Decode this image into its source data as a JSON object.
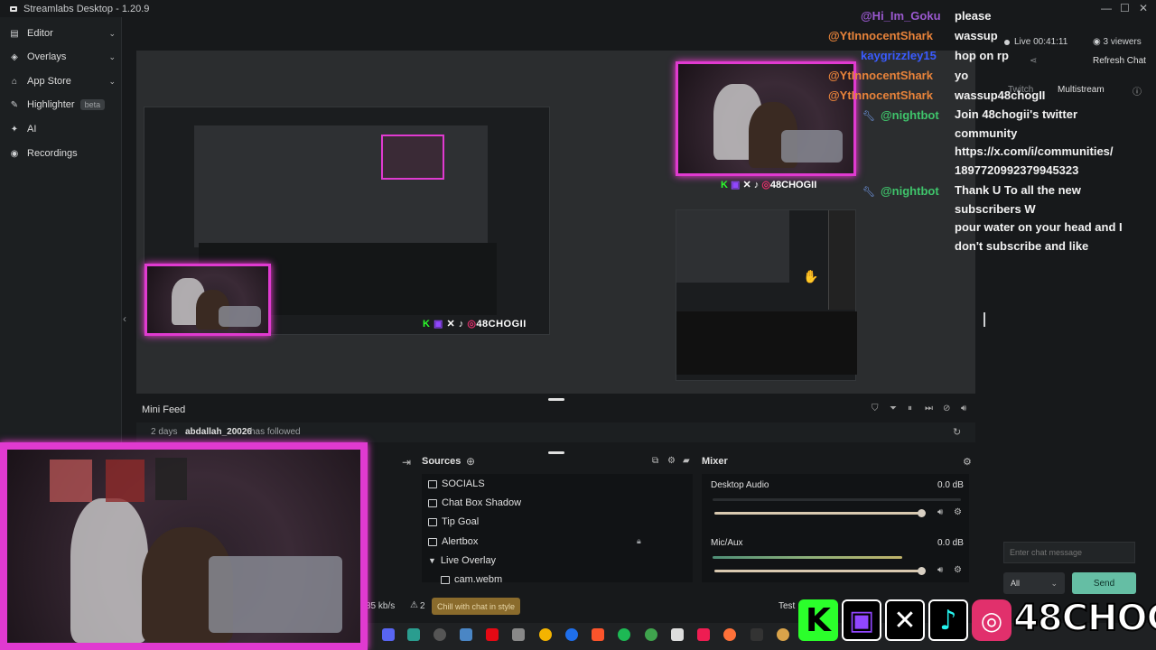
{
  "app": {
    "title": "Streamlabs Desktop - 1.20.9"
  },
  "sidebar": {
    "items": [
      {
        "label": "Editor",
        "icon": "editor-icon"
      },
      {
        "label": "Overlays",
        "icon": "overlays-icon"
      },
      {
        "label": "App Store",
        "icon": "app-store-icon"
      },
      {
        "label": "Highlighter",
        "icon": "highlighter-icon",
        "badge": "beta"
      },
      {
        "label": "AI",
        "icon": "ai-icon"
      },
      {
        "label": "Recordings",
        "icon": "recordings-icon"
      }
    ]
  },
  "chat": {
    "messages": [
      {
        "user": "@Hi_Im_Goku",
        "text": "please",
        "color": "#9b59d0"
      },
      {
        "user": "@YtInnocentShark",
        "text": "wassup",
        "color": "#e8833a"
      },
      {
        "user": "kaygrizzley15",
        "text": "hop on rp",
        "color": "#3a5bff"
      },
      {
        "user": "@YtInnocentShark",
        "text": "yo",
        "color": "#e8833a"
      },
      {
        "user": "@YtInnocentShark",
        "text": "wassup48chogII",
        "color": "#e8833a"
      },
      {
        "user": "@nightbot",
        "text": "Join 48chogii's twitter community https://x.com/i/communities/1897720992379945323",
        "color": "#3fc46b"
      },
      {
        "user": "@nightbot",
        "text": "Thank U To all the new subscribers W pour water on your head and I don't subscribe and like",
        "color": "#3fc46b"
      }
    ],
    "nightbot_line1": [
      "Join 48chogii's twitter",
      "community",
      "https://x.com/i/communities/",
      "1897720992379945323"
    ],
    "nightbot_line2": [
      "Thank U To all the new",
      "subscribers W",
      "pour water on your head and I",
      "don't subscribe and like"
    ]
  },
  "right_panel": {
    "live_label": "Live 00:41:11",
    "viewers": "3 viewers",
    "refresh_chat": "Refresh Chat",
    "tabs": [
      "Twitch",
      "Multistream"
    ],
    "chat_placeholder": "Enter chat message",
    "chat_target": "All",
    "send": "Send"
  },
  "mini_feed": {
    "title": "Mini Feed",
    "event": {
      "time": "2 days",
      "user": "abdallah_20026",
      "action": "has followed"
    }
  },
  "sources": {
    "title": "Sources",
    "items": [
      "SOCIALS",
      "Chat Box Shadow",
      "Tip Goal",
      "Alertbox",
      "Live Overlay",
      "cam.webm"
    ]
  },
  "mixer": {
    "title": "Mixer",
    "channels": [
      {
        "name": "Desktop Audio",
        "db": "0.0 dB",
        "level": 0.9
      },
      {
        "name": "Mic/Aux",
        "db": "0.0 dB",
        "level": 0.9
      }
    ]
  },
  "footer": {
    "bitrate": "85 kb/s",
    "warnings": "2",
    "promo": "Chill with chat in style",
    "test_label": "Test"
  },
  "overlay": {
    "social_handle": "48CHOGII",
    "colors": {
      "kick": "#2bff2b",
      "twitch": "#9146ff",
      "instagram": "#e1306c",
      "cam_border": "#e03ad0"
    }
  },
  "nested_preview": {
    "handle": "48CHOGII"
  }
}
